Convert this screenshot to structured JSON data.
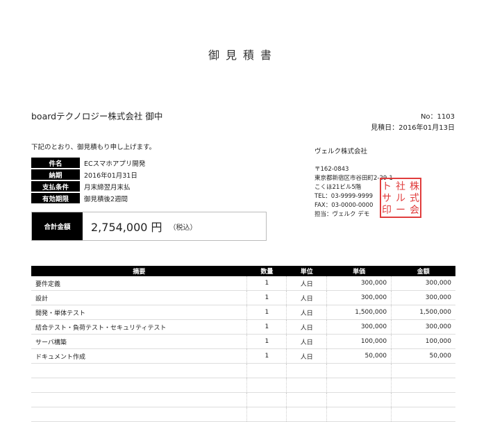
{
  "document": {
    "title": "御見積書",
    "client": "boardテクノロジー株式会社 御中",
    "number_line": "No：1103",
    "date_line": "見積日：2016年01月13日",
    "intro": "下記のとおり、御見積もり申し上げます。"
  },
  "info": [
    {
      "label": "件名",
      "value": "ECスマホアプリ開発"
    },
    {
      "label": "納期",
      "value": "2016年01月31日"
    },
    {
      "label": "支払条件",
      "value": "月末締翌月末払"
    },
    {
      "label": "有効期限",
      "value": "御見積後2週間"
    }
  ],
  "total": {
    "label": "合計金額",
    "amount": "2,754,000 円",
    "tax_note": "（税込）"
  },
  "issuer": {
    "company": "ヴェルク株式会社",
    "address_lines": [
      "〒162-0843",
      "東京都新宿区市谷田町2-29-1",
      "こくほ21ビル5階",
      "TEL：03-9999-9999",
      "FAX：03-0000-0000",
      "担当：ヴェルク デモ"
    ],
    "seal_text": "株式会社ルートサービス印",
    "seal_color": "#e03c3c"
  },
  "table": {
    "headers": [
      "摘要",
      "数量",
      "単位",
      "単価",
      "金額"
    ],
    "rows": [
      [
        "要件定義",
        "1",
        "人日",
        "300,000",
        "300,000"
      ],
      [
        "設計",
        "1",
        "人日",
        "300,000",
        "300,000"
      ],
      [
        "開発・単体テスト",
        "1",
        "人日",
        "1,500,000",
        "1,500,000"
      ],
      [
        "結合テスト・負荷テスト・セキュリティテスト",
        "1",
        "人日",
        "300,000",
        "300,000"
      ],
      [
        "サーバ構築",
        "1",
        "人日",
        "100,000",
        "100,000"
      ],
      [
        "ドキュメント作成",
        "1",
        "人日",
        "50,000",
        "50,000"
      ],
      [
        "",
        "",
        "",
        "",
        ""
      ],
      [
        "",
        "",
        "",
        "",
        ""
      ],
      [
        "",
        "",
        "",
        "",
        ""
      ],
      [
        "",
        "",
        "",
        "",
        ""
      ]
    ]
  }
}
